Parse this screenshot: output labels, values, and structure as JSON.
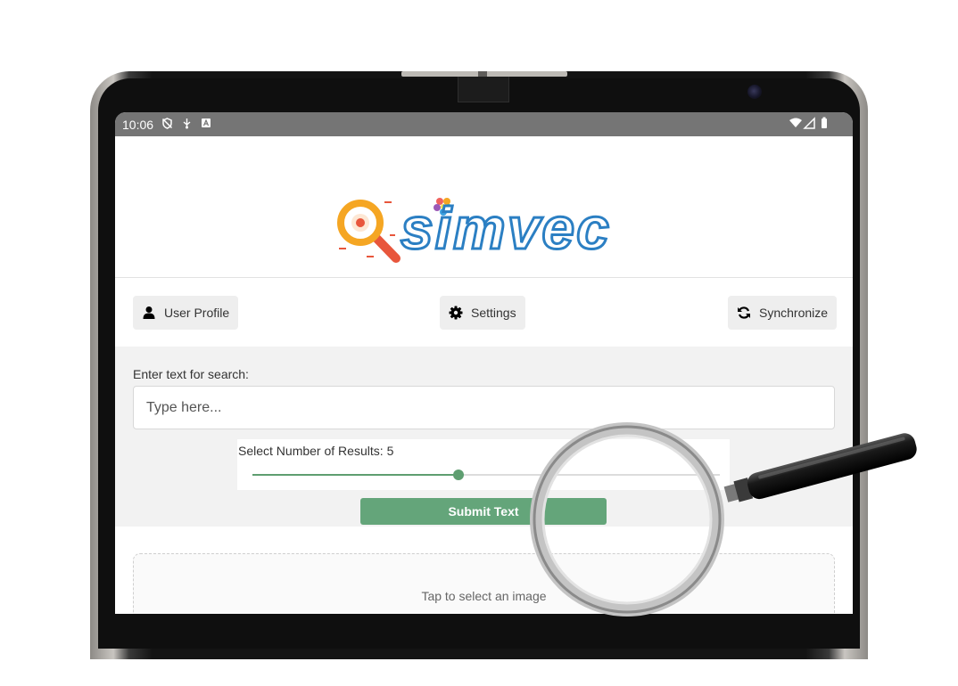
{
  "status_bar": {
    "time": "10:06",
    "left_icons": [
      "shield-off-icon",
      "usb-icon",
      "android-icon"
    ],
    "right_icons": [
      "wifi-icon",
      "signal-icon",
      "battery-icon"
    ]
  },
  "logo": {
    "text": "simvec",
    "icon": "magnifier-eye-icon"
  },
  "nav": {
    "user_profile": {
      "label": "User Profile",
      "icon": "user-icon"
    },
    "settings": {
      "label": "Settings",
      "icon": "gear-icon"
    },
    "synchronize": {
      "label": "Synchronize",
      "icon": "sync-icon"
    }
  },
  "search": {
    "label": "Enter text for search:",
    "placeholder": "Type here...",
    "value": ""
  },
  "results": {
    "label": "Select Number of Results:",
    "value": "5",
    "slider_fraction": 0.44
  },
  "submit": {
    "label": "Submit Text"
  },
  "image_picker": {
    "text": "Tap to select an image"
  },
  "colors": {
    "accent": "#64a57a",
    "status_bar": "#757575",
    "logo_orange": "#f5a623",
    "logo_blue": "#2b7fc3"
  }
}
